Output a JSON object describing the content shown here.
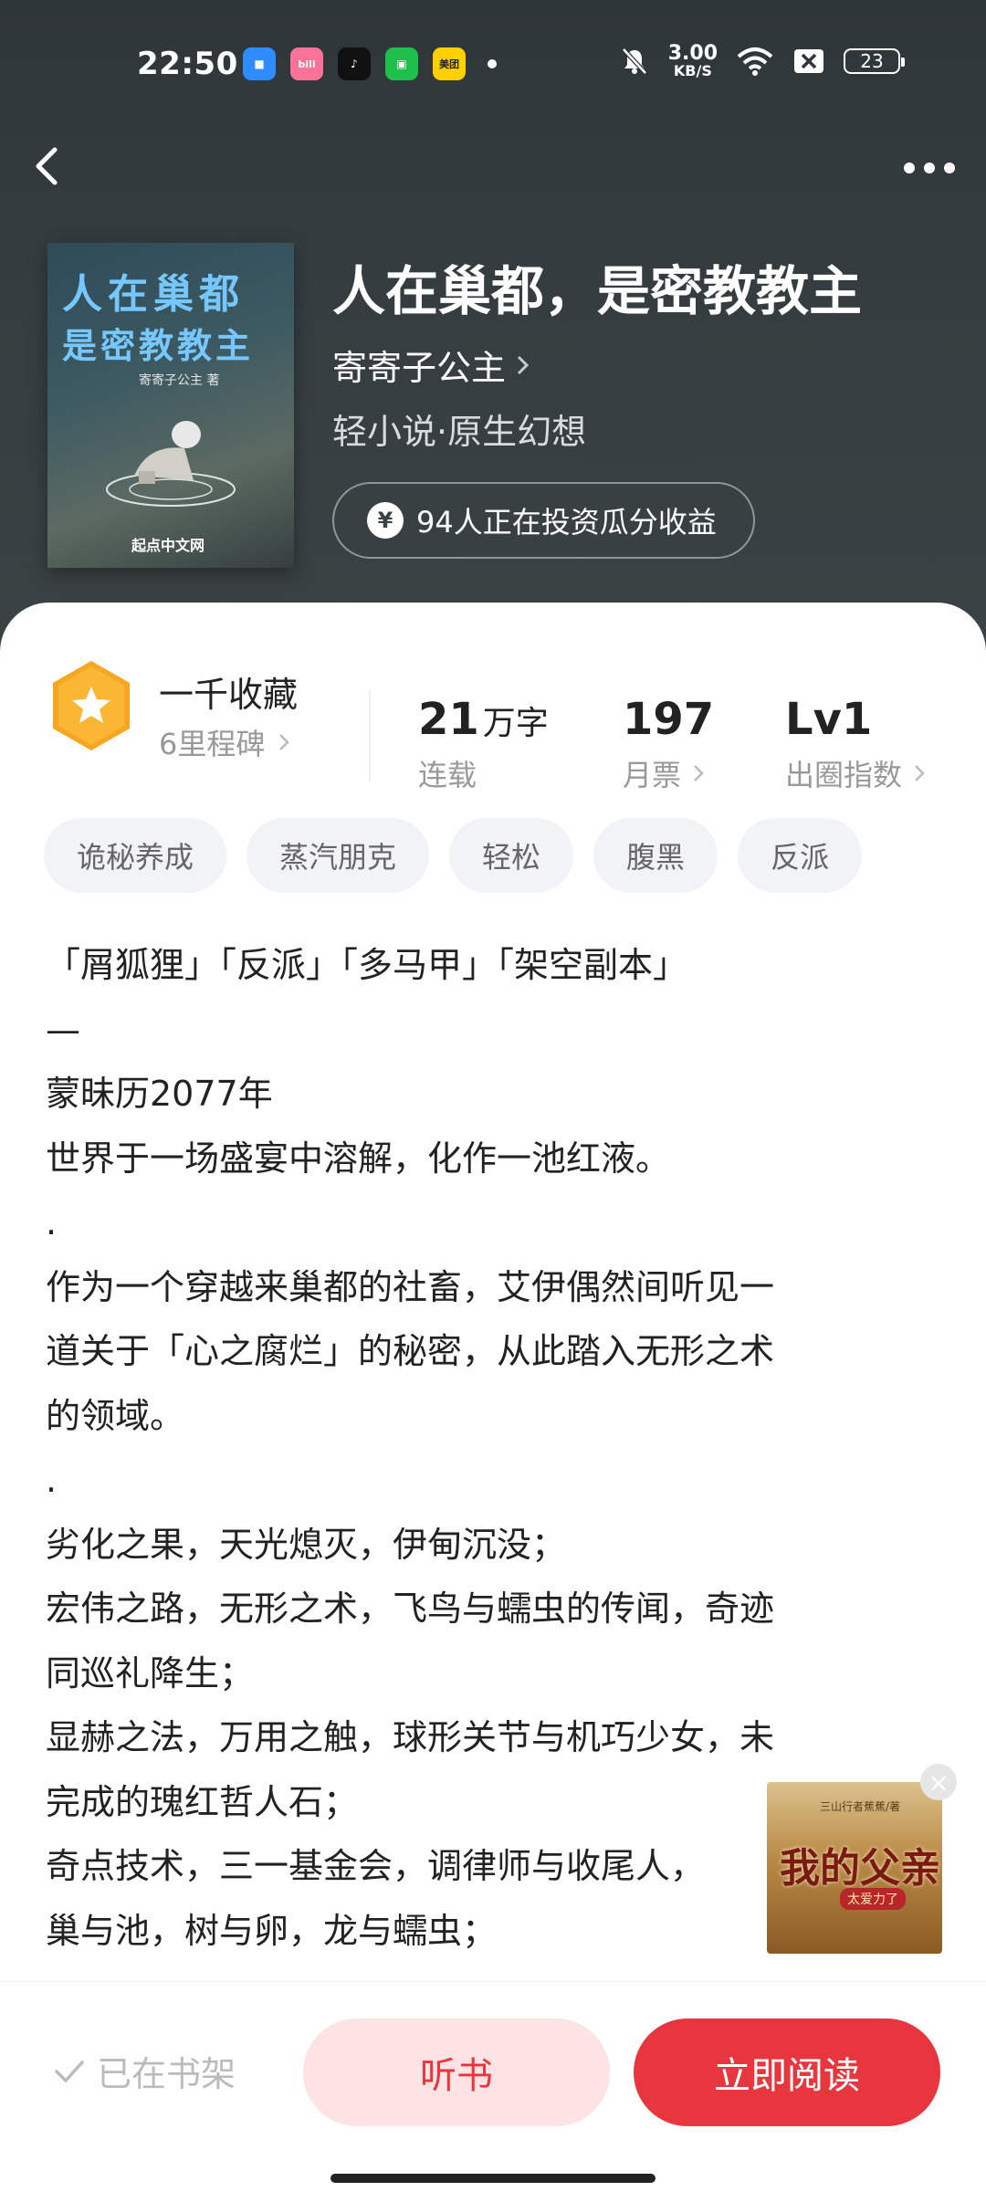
{
  "status_bar": {
    "time": "22:50",
    "net_speed_value": "3.00",
    "net_speed_unit": "KB/S",
    "battery": "23",
    "apps": [
      {
        "name": "blue-app-icon",
        "color": "#2f8cff",
        "glyph": "■"
      },
      {
        "name": "bilibili-icon",
        "color": "#fb7299",
        "glyph": "bili"
      },
      {
        "name": "tiktok-icon",
        "color": "#111111",
        "glyph": "♪"
      },
      {
        "name": "green-app-icon",
        "color": "#1fbf4c",
        "glyph": "▣"
      },
      {
        "name": "meituan-icon",
        "color": "#ffd100",
        "glyph": "美团"
      }
    ]
  },
  "book": {
    "title": "人在巢都，是密教教主",
    "author": "寄寄子公主",
    "genre": "轻小说·原生幻想",
    "invest_text": "94人正在投资瓜分收益",
    "cover": {
      "title_line1": "人在巢都",
      "title_line2": "是密教教主",
      "author": "寄寄子公主 著",
      "publisher": "起点中文网"
    }
  },
  "stats": {
    "collect_title": "一千收藏",
    "collect_sub": "6里程碑",
    "words_value": "21",
    "words_unit": "万字",
    "words_label": "连载",
    "monthly_value": "197",
    "monthly_label": "月票",
    "level_value": "Lv1",
    "level_label": "出圈指数"
  },
  "tags": [
    "诡秘养成",
    "蒸汽朋克",
    "轻松",
    "腹黑",
    "反派"
  ],
  "description_lines": [
    "「屑狐狸」「反派」「多马甲」「架空副本」",
    "—",
    "蒙昧历2077年",
    "世界于一场盛宴中溶解，化作一池红液。",
    ".",
    "作为一个穿越来巢都的社畜，艾伊偶然间听见一",
    "道关于「心之腐烂」的秘密，从此踏入无形之术",
    "的领域。",
    ".",
    "劣化之果，天光熄灭，伊甸沉没；",
    "宏伟之路，无形之术，飞鸟与蠕虫的传闻，奇迹",
    "同巡礼降生；",
    "显赫之法，万用之触，球形关节与机巧少女，未",
    "完成的瑰红哲人石；",
    "奇点技术，三一基金会，调律师与收尾人，",
    "巢与池，树与卵，龙与蠕虫；"
  ],
  "ad": {
    "title": "我的父亲",
    "small_text": "三山行者蕉蕉/著",
    "tag": "太爱力了"
  },
  "bottom_bar": {
    "shelf_label": "已在书架",
    "listen_label": "听书",
    "read_label": "立即阅读"
  },
  "colors": {
    "accent": "#e8363f",
    "accent_soft": "#fde3e3",
    "hero_bg": "#353d40",
    "medal": "#f6a623"
  }
}
